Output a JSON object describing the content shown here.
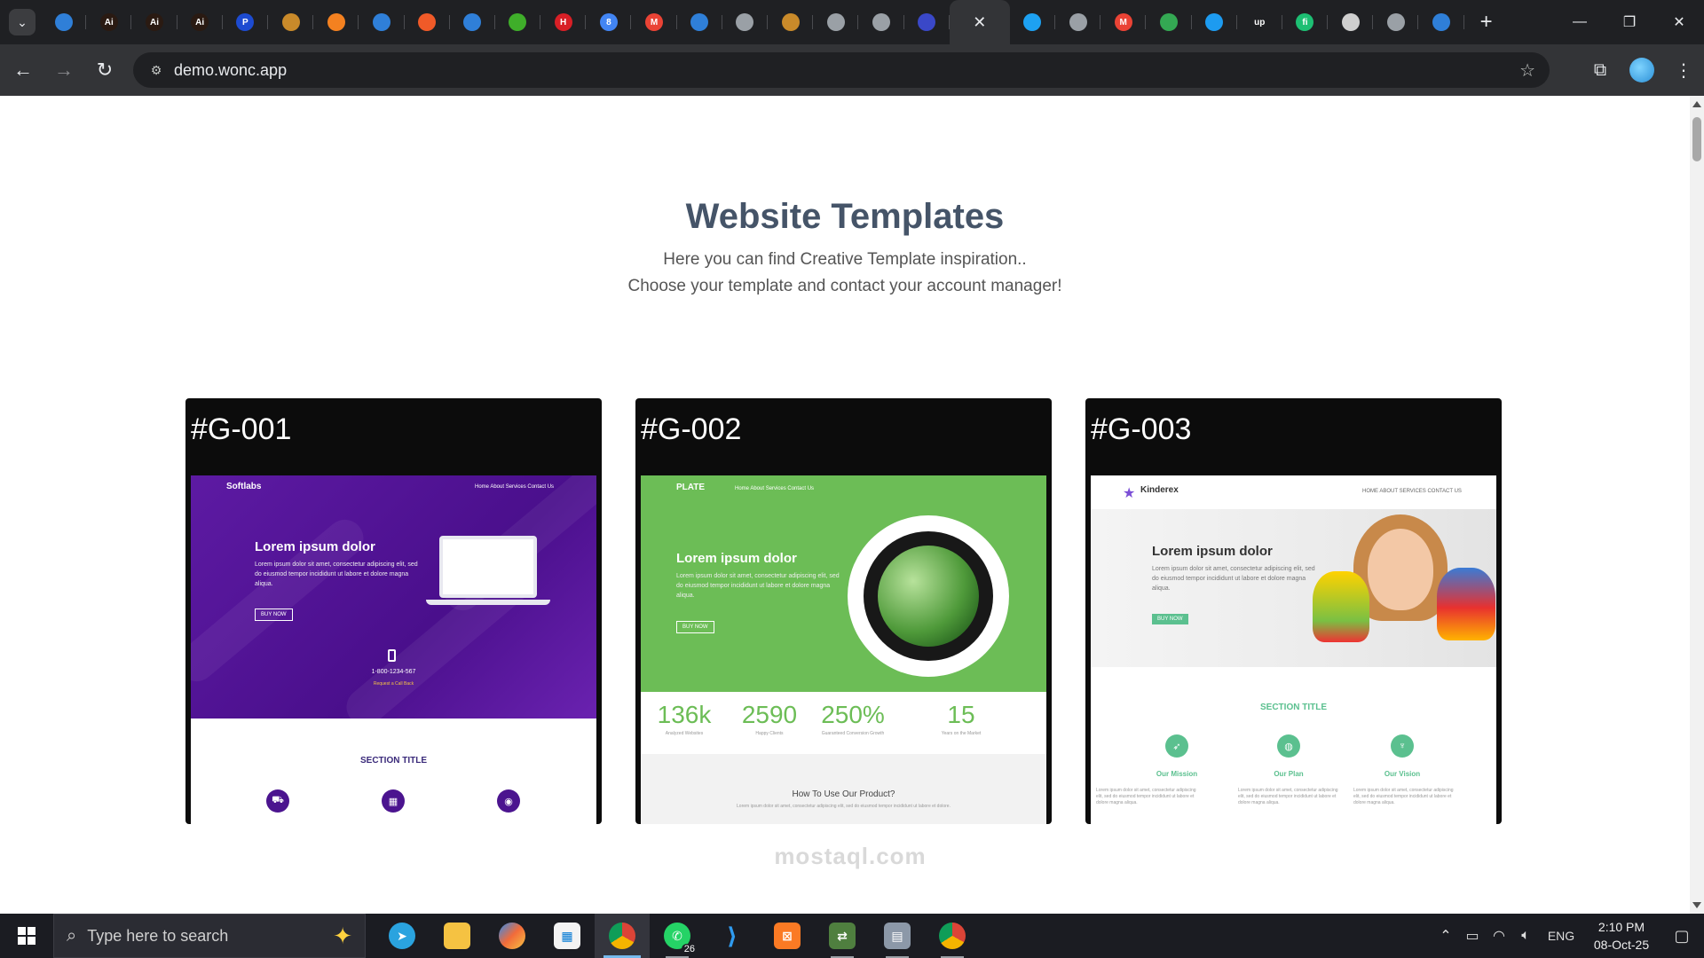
{
  "browser": {
    "tabs": [
      {
        "icon": "wonc-icon",
        "glyph": "",
        "color": "#2f7fd8"
      },
      {
        "icon": "adobe-ai-icon",
        "glyph": "Ai",
        "color": "#2a1a12"
      },
      {
        "icon": "adobe-ai-icon",
        "glyph": "Ai",
        "color": "#2a1a12"
      },
      {
        "icon": "adobe-ai-icon",
        "glyph": "Ai",
        "color": "#2a1a12"
      },
      {
        "icon": "p-icon",
        "glyph": "P",
        "color": "#1d4bd1"
      },
      {
        "icon": "ridge-icon",
        "glyph": "",
        "color": "#c98a2a"
      },
      {
        "icon": "cloudflare-icon",
        "glyph": "",
        "color": "#f48120"
      },
      {
        "icon": "wonc-icon",
        "glyph": "",
        "color": "#2f7fd8"
      },
      {
        "icon": "orange-circle-icon",
        "glyph": "",
        "color": "#f05a28"
      },
      {
        "icon": "wonc-icon",
        "glyph": "",
        "color": "#2f7fd8"
      },
      {
        "icon": "green-globe-icon",
        "glyph": "",
        "color": "#3fae2a"
      },
      {
        "icon": "h-icon",
        "glyph": "H",
        "color": "#d81f26"
      },
      {
        "icon": "calendar-icon",
        "glyph": "8",
        "color": "#4285f4"
      },
      {
        "icon": "gmail-icon",
        "glyph": "M",
        "color": "#ea4335"
      },
      {
        "icon": "wonc-icon",
        "glyph": "",
        "color": "#2f7fd8"
      },
      {
        "icon": "globe-icon",
        "glyph": "",
        "color": "#9aa0a6"
      },
      {
        "icon": "ridge-icon",
        "glyph": "",
        "color": "#c98a2a"
      },
      {
        "icon": "globe-icon",
        "glyph": "",
        "color": "#9aa0a6"
      },
      {
        "icon": "globe-icon",
        "glyph": "",
        "color": "#9aa0a6"
      },
      {
        "icon": "cloud-icon",
        "glyph": "",
        "color": "#3a48c8"
      }
    ],
    "tabs_after": [
      {
        "icon": "blue-dot-icon",
        "glyph": "",
        "color": "#1da1f2"
      },
      {
        "icon": "globe-icon",
        "glyph": "",
        "color": "#9aa0a6"
      },
      {
        "icon": "gmail-icon",
        "glyph": "M",
        "color": "#ea4335"
      },
      {
        "icon": "meet-icon",
        "glyph": "",
        "color": "#34a853"
      },
      {
        "icon": "ring-icon",
        "glyph": "",
        "color": "#1d9bf0"
      },
      {
        "icon": "upwork-icon",
        "glyph": "up",
        "color": "#1f2023"
      },
      {
        "icon": "fiverr-icon",
        "glyph": "fi",
        "color": "#1dbf73"
      },
      {
        "icon": "openai-icon",
        "glyph": "",
        "color": "#cfcfcf"
      },
      {
        "icon": "globe-icon",
        "glyph": "",
        "color": "#9aa0a6"
      },
      {
        "icon": "wonc-icon",
        "glyph": "",
        "color": "#2f7fd8"
      }
    ],
    "url": "demo.wonc.app"
  },
  "page": {
    "title": "Website Templates",
    "subtitle_line1": "Here you can find Creative Template inspiration..",
    "subtitle_line2": "Choose your template and contact your account manager!"
  },
  "cards": [
    {
      "code": "#G-001",
      "brand": "Softlabs",
      "nav": "Home   About   Services   Contact Us",
      "hero_title": "Lorem ipsum dolor",
      "hero_text": "Lorem ipsum dolor sit amet, consectetur adipiscing elit, sed do eiusmod tempor incididunt ut labore et dolore magna aliqua.",
      "button": "BUY NOW",
      "phone": "1-800-1234-567",
      "call": "Request a Call Back",
      "section_title": "SECTION TITLE"
    },
    {
      "code": "#G-002",
      "brand": "PLATE",
      "nav": "Home   About   Services   Contact Us",
      "hero_title": "Lorem ipsum dolor",
      "hero_text": "Lorem ipsum dolor sit amet, consectetur adipiscing elit, sed do eiusmod tempor incididunt ut labore et dolore magna aliqua.",
      "button": "BUY NOW",
      "stats": [
        {
          "value": "136k",
          "label": "Analyzed Websites"
        },
        {
          "value": "2590",
          "label": "Happy Clients"
        },
        {
          "value": "250%",
          "label": "Guaranteed Conversion Growth"
        },
        {
          "value": "15",
          "label": "Years on the Market"
        }
      ],
      "how": "How To Use Our Product?",
      "how_text": "Lorem ipsum dolor sit amet, consectetur adipiscing elit, sed do eiusmod tempor incididunt ut labore et dolore."
    },
    {
      "code": "#G-003",
      "brand": "Kinderex",
      "nav": "HOME   ABOUT   SERVICES   CONTACT US",
      "hero_title": "Lorem ipsum dolor",
      "hero_text": "Lorem ipsum dolor sit amet, consectetur adipiscing elit, sed do eiusmod tempor incididunt ut labore et dolore magna aliqua.",
      "button": "BUY NOW",
      "section_title": "SECTION TITLE",
      "features": [
        "Our Mission",
        "Our Plan",
        "Our Vision"
      ],
      "feature_text": "Lorem ipsum dolor sit amet, consectetur adipiscing elit, sed do eiusmod tempor incididunt ut labore et dolore magna aliqua."
    }
  ],
  "watermark": "mostaql.com",
  "taskbar": {
    "search_placeholder": "Type here to search",
    "whatsapp_badge": "26",
    "language": "ENG",
    "time": "2:10 PM",
    "date": "08-Oct-25"
  }
}
